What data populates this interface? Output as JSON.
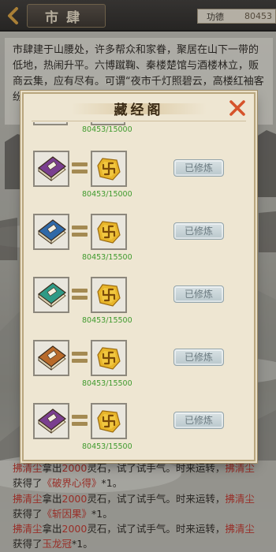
{
  "header": {
    "title": "市肆",
    "merit_label": "功德",
    "merit_value": "80453"
  },
  "description": "市肆建于山腰处，许多帮众和家眷，聚居在山下一带的低地，热闹升平。六博蹴鞠、秦楼楚馆与酒楼林立，贩商云集，应有尽有。可谓“夜市千灯照碧云，高楼红袖客纷纷。”",
  "modal": {
    "title": "藏经阁",
    "top_cost": "80453/15000",
    "rows": [
      {
        "book_color": "#7a3f8f",
        "book_name": "book-purple",
        "cost": "80453/15000",
        "button": "已修炼"
      },
      {
        "book_color": "#2f69a8",
        "book_name": "book-blue",
        "cost": "80453/15500",
        "button": "已修炼"
      },
      {
        "book_color": "#2f9a86",
        "book_name": "book-teal",
        "cost": "80453/15500",
        "button": "已修炼"
      },
      {
        "book_color": "#b86a2a",
        "book_name": "book-orange",
        "cost": "80453/15500",
        "button": "已修炼"
      },
      {
        "book_color": "#7a3f8f",
        "book_name": "book-purple",
        "cost": "80453/15500",
        "button": "已修炼"
      }
    ],
    "coin_color": "#e8b52a",
    "cost_color": "#3f9a2d"
  },
  "log": [
    {
      "name": "拂清尘",
      "mid1": "拿出",
      "amount": "2000",
      "mid2": "灵石，试了试手气。时来运转，",
      "name2": "拂清尘",
      "line2_prefix": "获得了",
      "item": "《破界心得》",
      "suffix": "*1。"
    },
    {
      "name": "拂清尘",
      "mid1": "拿出",
      "amount": "2000",
      "mid2": "灵石，试了试手气。时来运转，",
      "name2": "拂清尘",
      "line2_prefix": "获得了",
      "item": "《斩因果》",
      "suffix": "*1。"
    },
    {
      "name": "拂清尘",
      "mid1": "拿出",
      "amount": "2000",
      "mid2": "灵石，试了试手气。时来运转，",
      "name2": "拂清尘",
      "line2_prefix": "获得了",
      "item": "玉龙冠",
      "suffix": "*1。"
    }
  ],
  "icons": {
    "back": "back-arrow-icon",
    "close": "close-icon",
    "book": "scripture-book-icon",
    "coin": "swastika-coin-icon"
  }
}
